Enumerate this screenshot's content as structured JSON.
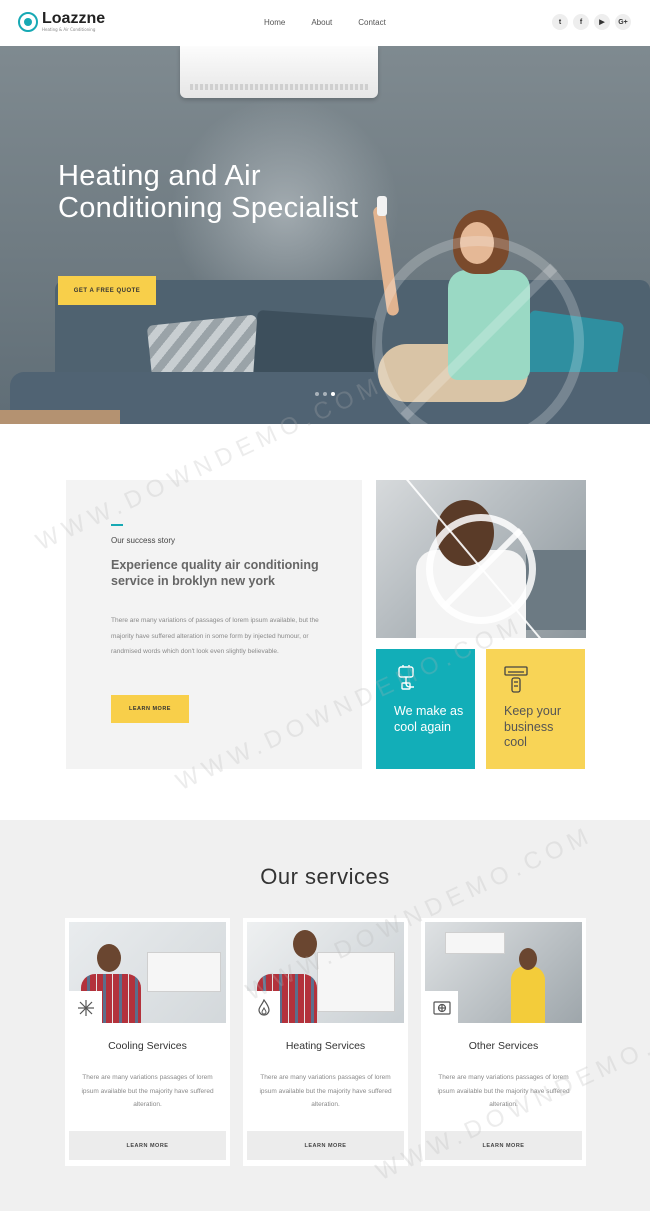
{
  "brand": {
    "name": "Loazzne",
    "tagline": "Heating & Air Conditioning",
    "accent": "#12aeb8",
    "yellow": "#f8cf4a"
  },
  "nav": {
    "items": [
      "Home",
      "About",
      "Contact"
    ]
  },
  "socials": [
    {
      "icon": "twitter-icon",
      "glyph": "t"
    },
    {
      "icon": "facebook-icon",
      "glyph": "f"
    },
    {
      "icon": "youtube-icon",
      "glyph": "▶"
    },
    {
      "icon": "google-plus-icon",
      "glyph": "G+"
    }
  ],
  "hero": {
    "title": "Heating and Air Conditioning Specialist",
    "cta": "GET A FREE QUOTE"
  },
  "story": {
    "eyebrow": "Our success story",
    "heading": "Experience quality air conditioning service in broklyn new york",
    "text": "There are many variations of passages of lorem ipsum available, but the majority have suffered alteration in some form by injected humour, or randmised words which don't look even slightly believable.",
    "cta": "LEARN MORE"
  },
  "tiles": [
    {
      "text": "We make as cool again",
      "icon": "plug-icon"
    },
    {
      "text": "Keep your business cool",
      "icon": "ac-remote-icon"
    }
  ],
  "services": {
    "title": "Our services",
    "cards": [
      {
        "title": "Cooling Services",
        "icon": "snowflake-icon",
        "text": "There are many variations passages of lorem ipsum available but the majority have suffered alteration.",
        "cta": "LEARN MORE"
      },
      {
        "title": "Heating Services",
        "icon": "flame-icon",
        "text": "There are many variations passages of lorem ipsum available but the majority have suffered alteration.",
        "cta": "LEARN MORE"
      },
      {
        "title": "Other Services",
        "icon": "ac-unit-icon",
        "text": "There are many variations passages of lorem ipsum available but the majority have suffered alteration.",
        "cta": "LEARN MORE"
      }
    ]
  },
  "watermark": "WWW.DOWNDEMO.COM"
}
